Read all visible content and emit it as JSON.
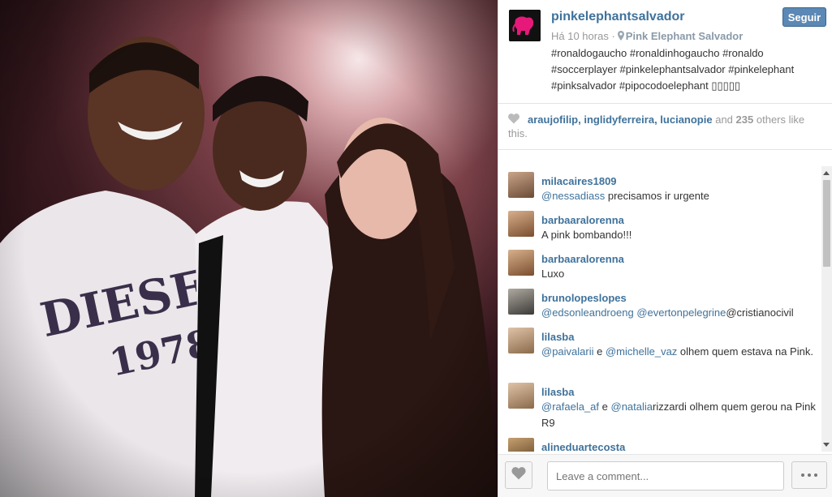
{
  "post": {
    "username": "pinkelephantsalvador",
    "follow_label": "Seguir",
    "time": "Há 10 horas",
    "separator": "·",
    "location": "Pink Elephant Salvador",
    "caption": "#ronaldogaucho #ronaldinhogaucho #ronaldo #soccerplayer #pinkelephantsalvador #pinkelephant #pinksalvador #pipocodoelephant ▯▯▯▯▯",
    "avatar_text": "PINK ELEPHANT",
    "accent_color": "#3f729b",
    "brand_color": "#e6197a"
  },
  "likes": {
    "user1": "araujofilip",
    "user2": "inglidyferreira",
    "user3": "lucianopie",
    "and": "and",
    "count": "235",
    "suffix": "others like this."
  },
  "comments": [
    {
      "user": "milacaires1809",
      "parts": [
        {
          "t": "@nessadiass",
          "m": true
        },
        {
          "t": " precisamos ir urgente",
          "m": false
        }
      ]
    },
    {
      "user": "barbaaralorenna",
      "parts": [
        {
          "t": "A pink bombando!!!",
          "m": false
        }
      ]
    },
    {
      "user": "barbaaralorenna",
      "parts": [
        {
          "t": "Luxo",
          "m": false
        }
      ]
    },
    {
      "user": "brunolopeslopes",
      "parts": [
        {
          "t": "@edsonleandroeng",
          "m": true
        },
        {
          "t": " ",
          "m": false
        },
        {
          "t": "@evertonpelegrine",
          "m": true
        },
        {
          "t": "@cristianocivil",
          "m": false
        }
      ]
    },
    {
      "user": "lilasba",
      "parts": [
        {
          "t": "@paivalarii",
          "m": true
        },
        {
          "t": " e ",
          "m": false
        },
        {
          "t": "@michelle_vaz",
          "m": true
        },
        {
          "t": " olhem quem estava na Pink.",
          "m": false
        }
      ]
    },
    {
      "user": "lilasba",
      "parts": [
        {
          "t": "@rafaela_af",
          "m": true
        },
        {
          "t": " e ",
          "m": false
        },
        {
          "t": "@natalia",
          "m": true
        },
        {
          "t": "rizzardi olhem quem gerou na Pink R9",
          "m": false
        }
      ]
    },
    {
      "user": "alineduartecosta",
      "parts": []
    }
  ],
  "comment_box": {
    "placeholder": "Leave a comment..."
  },
  "icons": {
    "location": "map-pin-icon",
    "like": "heart-icon",
    "more": "ellipsis-icon"
  }
}
